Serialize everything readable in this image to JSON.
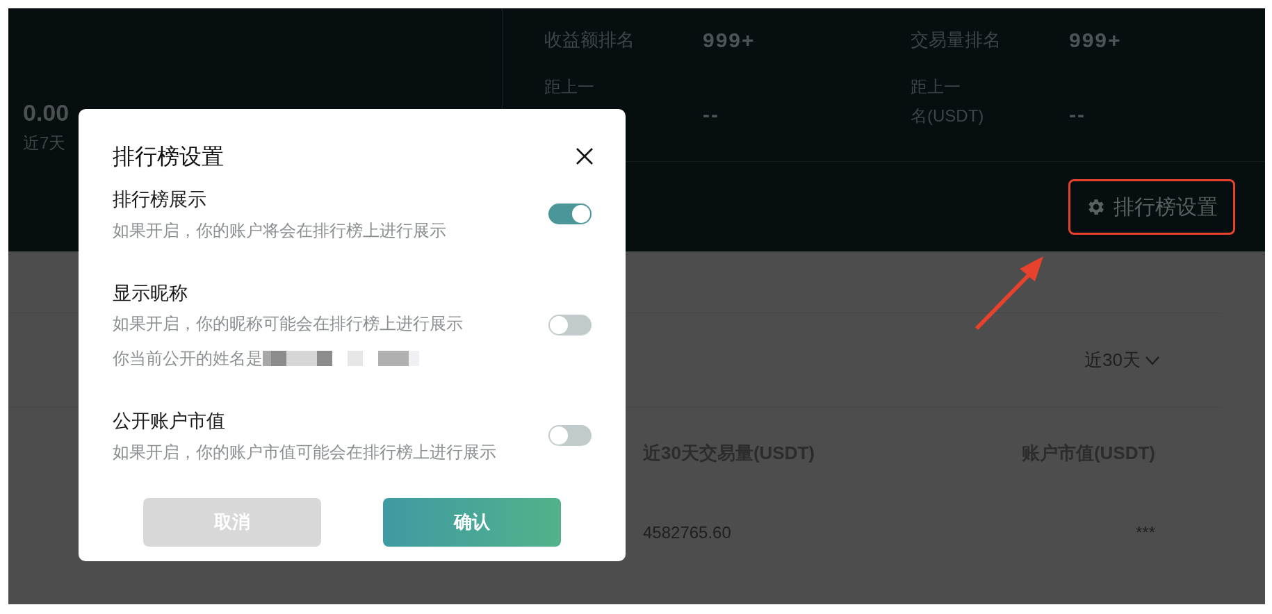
{
  "summary": {
    "value": "0.00",
    "label": "近7天"
  },
  "stats": [
    {
      "label": "收益额排名",
      "value": "999+"
    },
    {
      "label": "交易量排名",
      "value": "999+"
    },
    {
      "label_lines": [
        "距上一"
      ],
      "value": "--"
    },
    {
      "label_lines": [
        "距上一",
        "名(USDT)"
      ],
      "value": "--"
    }
  ],
  "settings_button": {
    "label": "排行榜设置"
  },
  "period_dropdown": {
    "value": "近30天"
  },
  "table": {
    "columns": [
      "近30天交易量(USDT)",
      "账户市值(USDT)"
    ],
    "rows": [
      [
        "4582765.60",
        "***"
      ]
    ]
  },
  "dialog": {
    "title": "排行榜设置",
    "settings": [
      {
        "title": "排行榜展示",
        "description": "如果开启，你的账户将会在排行榜上进行展示",
        "on": true
      },
      {
        "title": "显示昵称",
        "description": "如果开启，你的昵称可能会在排行榜上进行展示",
        "note": "你当前公开的姓名是",
        "on": false
      },
      {
        "title": "公开账户市值",
        "description": "如果开启，你的账户市值可能会在排行榜上进行展示",
        "on": false
      }
    ],
    "buttons": [
      {
        "label": "取消",
        "kind": "cancel"
      },
      {
        "label": "确认",
        "kind": "confirm"
      }
    ]
  }
}
